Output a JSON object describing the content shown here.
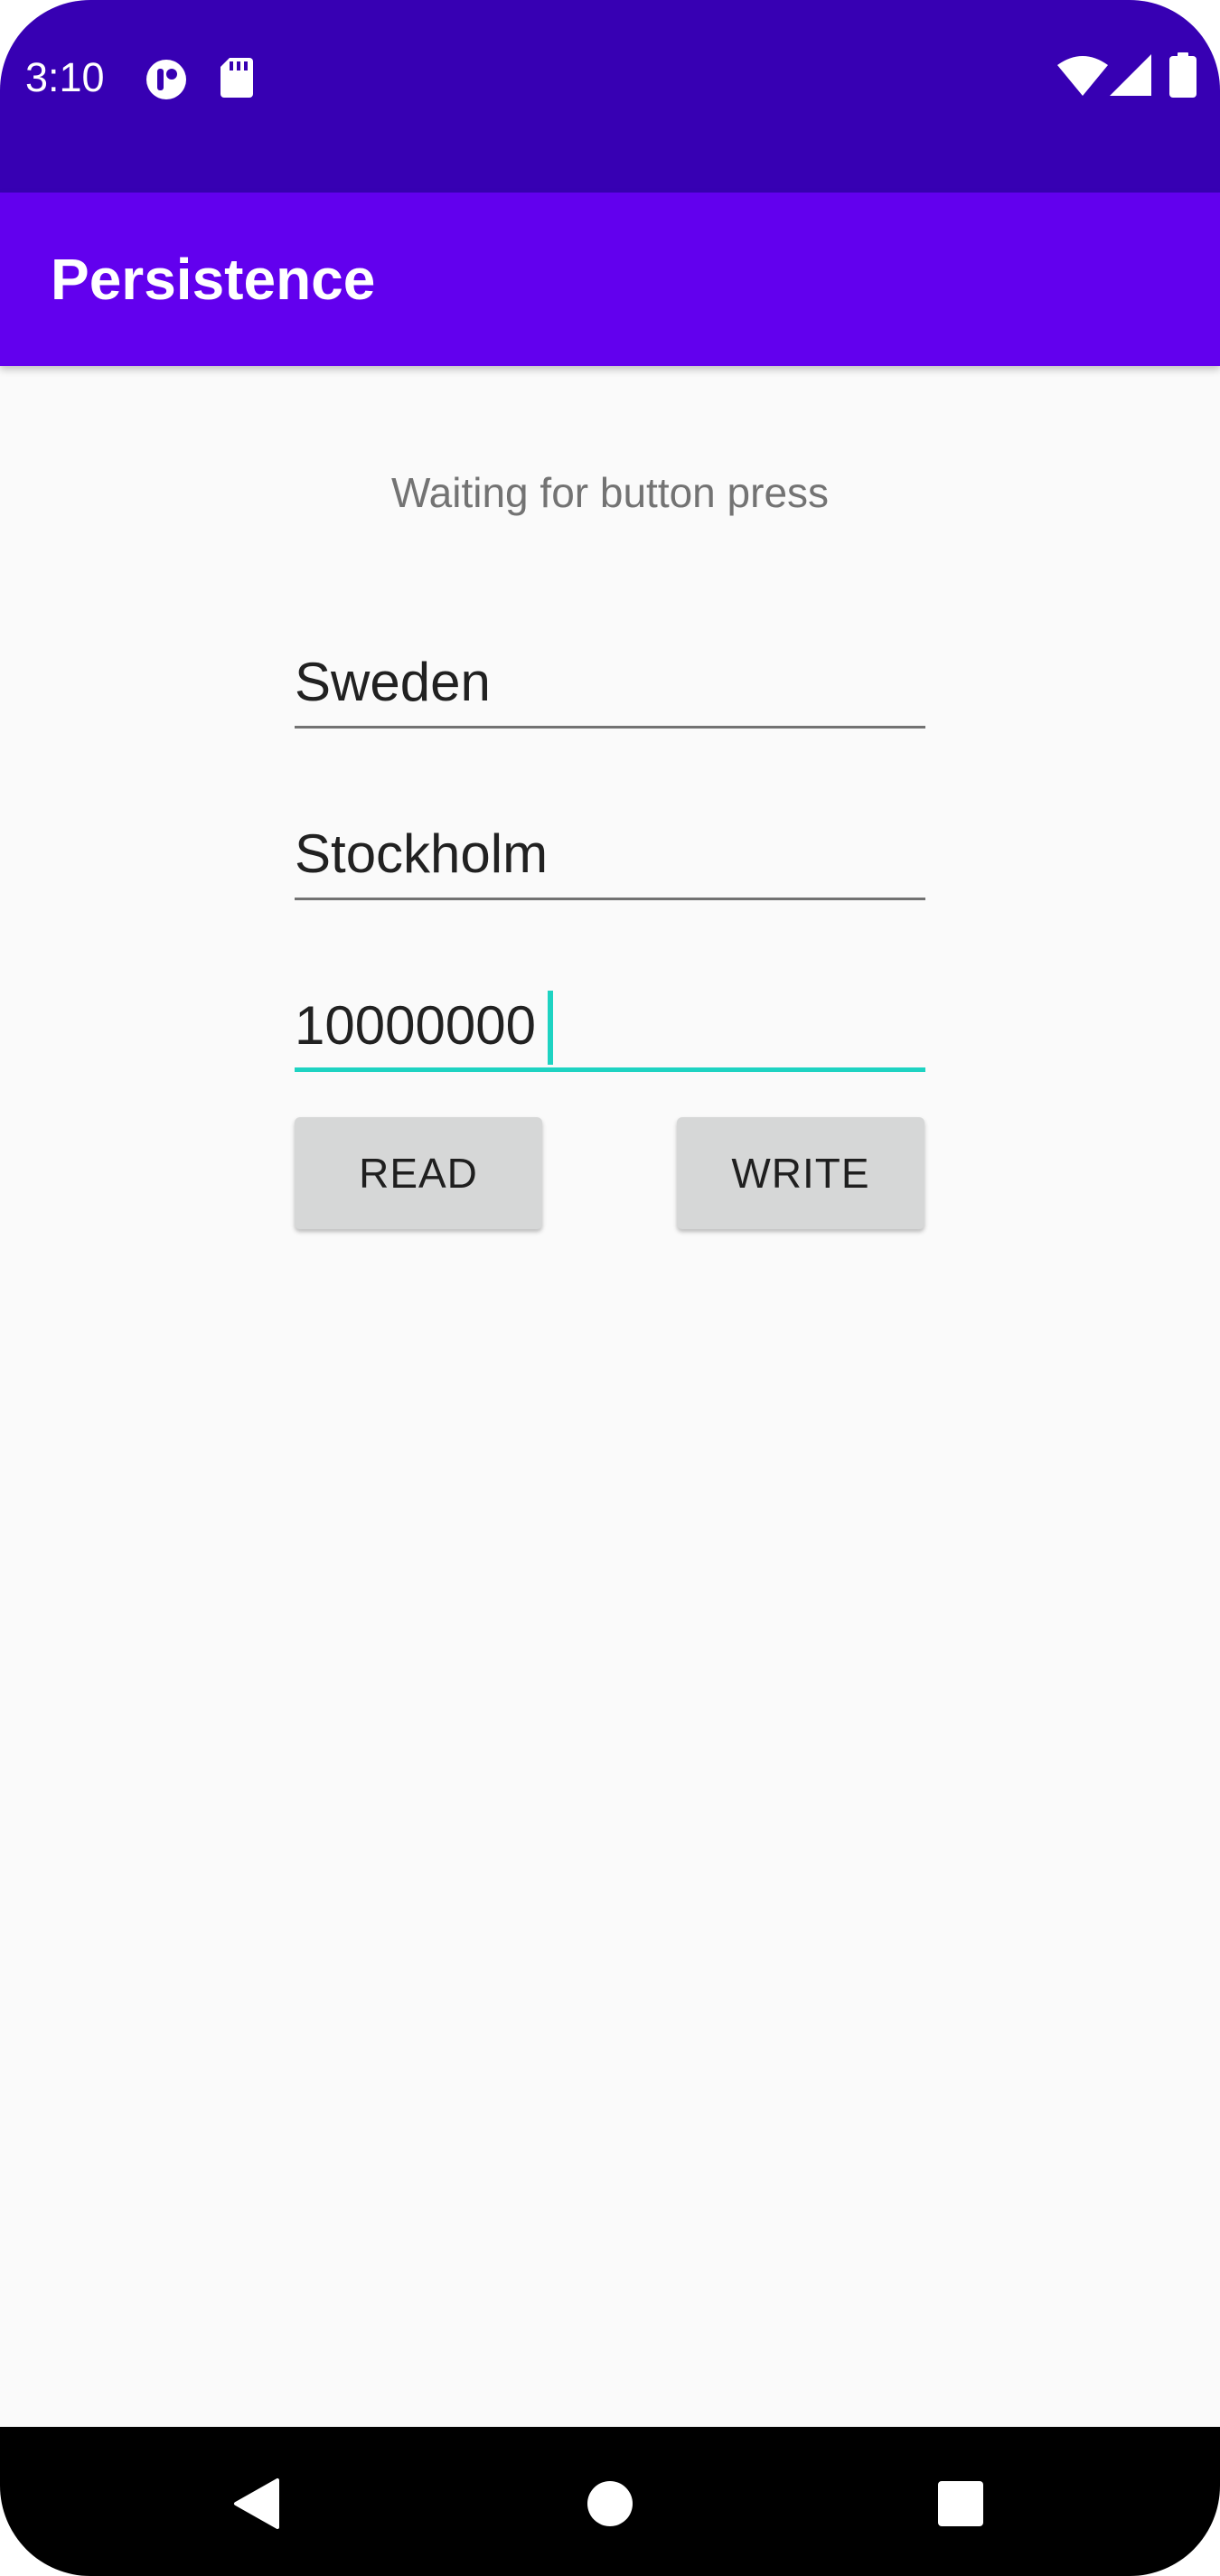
{
  "status_bar": {
    "time": "3:10",
    "icons": [
      "app-notification-icon",
      "sd-card-icon",
      "wifi-icon",
      "cell-signal-icon",
      "battery-icon"
    ],
    "background": "#3700b3"
  },
  "app_bar": {
    "title": "Persistence",
    "background": "#6200ee"
  },
  "main": {
    "status_message": "Waiting for button press",
    "fields": [
      {
        "value": "Sweden",
        "focused": false
      },
      {
        "value": "Stockholm",
        "focused": false
      },
      {
        "value": "10000000",
        "focused": true
      }
    ],
    "buttons": {
      "read_label": "READ",
      "write_label": "WRITE"
    },
    "accent_color": "#1ed3c2"
  },
  "nav_bar": {
    "items": [
      "back-icon",
      "home-icon",
      "recents-icon"
    ]
  }
}
